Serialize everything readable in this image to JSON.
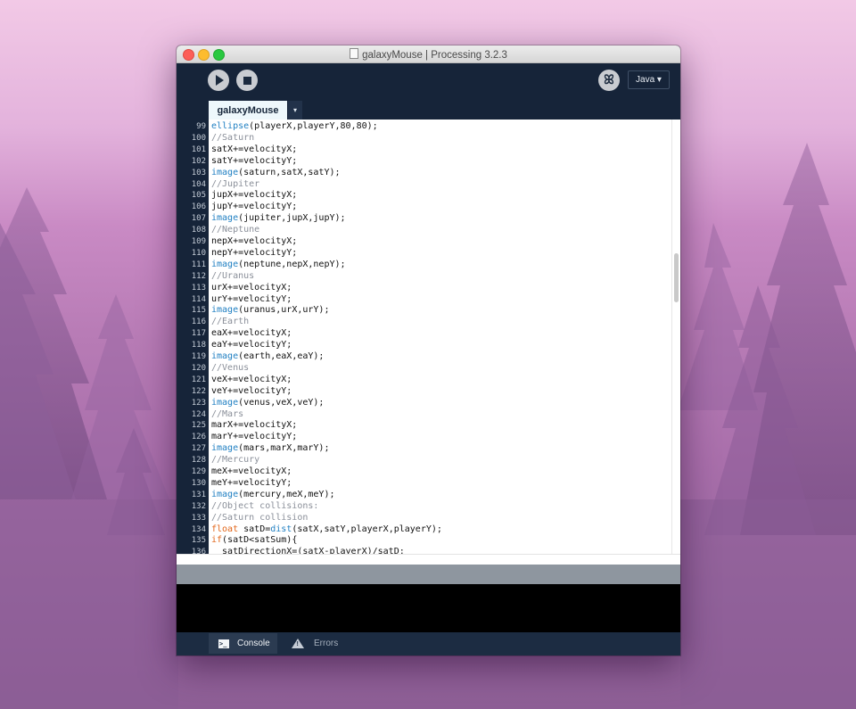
{
  "window": {
    "title": "galaxyMouse | Processing 3.2.3"
  },
  "toolbar": {
    "run_icon": "play-icon",
    "stop_icon": "stop-icon",
    "debug_icon": "debug-icon",
    "debug_glyph": "ꕤ",
    "mode_label": "Java ▾"
  },
  "tabs": [
    {
      "label": "galaxyMouse",
      "active": true
    }
  ],
  "tab_menu_glyph": "▾",
  "editor": {
    "lines": [
      {
        "no": "99",
        "segs": [
          {
            "t": "ellipse",
            "c": "fn"
          },
          {
            "t": "(playerX,playerY,80,80);",
            "c": "pl"
          }
        ]
      },
      {
        "no": "100",
        "segs": [
          {
            "t": "//Saturn",
            "c": "cm"
          }
        ]
      },
      {
        "no": "101",
        "segs": [
          {
            "t": "satX+=velocityX;",
            "c": "pl"
          }
        ]
      },
      {
        "no": "102",
        "segs": [
          {
            "t": "satY+=velocityY;",
            "c": "pl"
          }
        ]
      },
      {
        "no": "103",
        "segs": [
          {
            "t": "image",
            "c": "fn"
          },
          {
            "t": "(saturn,satX,satY);",
            "c": "pl"
          }
        ]
      },
      {
        "no": "104",
        "segs": [
          {
            "t": "//Jupiter",
            "c": "cm"
          }
        ]
      },
      {
        "no": "105",
        "segs": [
          {
            "t": "jupX+=velocityX;",
            "c": "pl"
          }
        ]
      },
      {
        "no": "106",
        "segs": [
          {
            "t": "jupY+=velocityY;",
            "c": "pl"
          }
        ]
      },
      {
        "no": "107",
        "segs": [
          {
            "t": "image",
            "c": "fn"
          },
          {
            "t": "(jupiter,jupX,jupY);",
            "c": "pl"
          }
        ]
      },
      {
        "no": "108",
        "segs": [
          {
            "t": "//Neptune",
            "c": "cm"
          }
        ]
      },
      {
        "no": "109",
        "segs": [
          {
            "t": "nepX+=velocityX;",
            "c": "pl"
          }
        ]
      },
      {
        "no": "110",
        "segs": [
          {
            "t": "nepY+=velocityY;",
            "c": "pl"
          }
        ]
      },
      {
        "no": "111",
        "segs": [
          {
            "t": "image",
            "c": "fn"
          },
          {
            "t": "(neptune,nepX,nepY);",
            "c": "pl"
          }
        ]
      },
      {
        "no": "112",
        "segs": [
          {
            "t": "//Uranus",
            "c": "cm"
          }
        ]
      },
      {
        "no": "113",
        "segs": [
          {
            "t": "urX+=velocityX;",
            "c": "pl"
          }
        ]
      },
      {
        "no": "114",
        "segs": [
          {
            "t": "urY+=velocityY;",
            "c": "pl"
          }
        ]
      },
      {
        "no": "115",
        "segs": [
          {
            "t": "image",
            "c": "fn"
          },
          {
            "t": "(uranus,urX,urY);",
            "c": "pl"
          }
        ]
      },
      {
        "no": "116",
        "segs": [
          {
            "t": "//Earth",
            "c": "cm"
          }
        ]
      },
      {
        "no": "117",
        "segs": [
          {
            "t": "eaX+=velocityX;",
            "c": "pl"
          }
        ]
      },
      {
        "no": "118",
        "segs": [
          {
            "t": "eaY+=velocityY;",
            "c": "pl"
          }
        ]
      },
      {
        "no": "119",
        "segs": [
          {
            "t": "image",
            "c": "fn"
          },
          {
            "t": "(earth,eaX,eaY);",
            "c": "pl"
          }
        ]
      },
      {
        "no": "120",
        "segs": [
          {
            "t": "//Venus",
            "c": "cm"
          }
        ]
      },
      {
        "no": "121",
        "segs": [
          {
            "t": "veX+=velocityX;",
            "c": "pl"
          }
        ]
      },
      {
        "no": "122",
        "segs": [
          {
            "t": "veY+=velocityY;",
            "c": "pl"
          }
        ]
      },
      {
        "no": "123",
        "segs": [
          {
            "t": "image",
            "c": "fn"
          },
          {
            "t": "(venus,veX,veY);",
            "c": "pl"
          }
        ]
      },
      {
        "no": "124",
        "segs": [
          {
            "t": "//Mars",
            "c": "cm"
          }
        ]
      },
      {
        "no": "125",
        "segs": [
          {
            "t": "marX+=velocityX;",
            "c": "pl"
          }
        ]
      },
      {
        "no": "126",
        "segs": [
          {
            "t": "marY+=velocityY;",
            "c": "pl"
          }
        ]
      },
      {
        "no": "127",
        "segs": [
          {
            "t": "image",
            "c": "fn"
          },
          {
            "t": "(mars,marX,marY);",
            "c": "pl"
          }
        ]
      },
      {
        "no": "128",
        "segs": [
          {
            "t": "//Mercury",
            "c": "cm"
          }
        ]
      },
      {
        "no": "129",
        "segs": [
          {
            "t": "meX+=velocityX;",
            "c": "pl"
          }
        ]
      },
      {
        "no": "130",
        "segs": [
          {
            "t": "meY+=velocityY;",
            "c": "pl"
          }
        ]
      },
      {
        "no": "131",
        "segs": [
          {
            "t": "image",
            "c": "fn"
          },
          {
            "t": "(mercury,meX,meY);",
            "c": "pl"
          }
        ]
      },
      {
        "no": "132",
        "segs": [
          {
            "t": "//Object collisions:",
            "c": "cm"
          }
        ]
      },
      {
        "no": "133",
        "segs": [
          {
            "t": "//Saturn collision",
            "c": "cm"
          }
        ]
      },
      {
        "no": "134",
        "segs": [
          {
            "t": "float",
            "c": "kw"
          },
          {
            "t": " satD=",
            "c": "pl"
          },
          {
            "t": "dist",
            "c": "fn"
          },
          {
            "t": "(satX,satY,playerX,playerY);",
            "c": "pl"
          }
        ]
      },
      {
        "no": "135",
        "segs": [
          {
            "t": "if",
            "c": "kw"
          },
          {
            "t": "(satD<satSum){",
            "c": "pl"
          }
        ]
      },
      {
        "no": "136",
        "segs": [
          {
            "t": "  satDirectionX=(satX-playerX)/satD;",
            "c": "pl"
          }
        ]
      }
    ]
  },
  "footer": {
    "console_label": "Console",
    "errors_label": "Errors",
    "console_icon": "console-icon",
    "console_glyph": ">_",
    "errors_icon": "warning-icon",
    "errors_glyph": "!"
  },
  "colors": {
    "function": "#1f7fc2",
    "comment": "#8a8f99",
    "keyword": "#e2661a",
    "plain": "#111111"
  }
}
